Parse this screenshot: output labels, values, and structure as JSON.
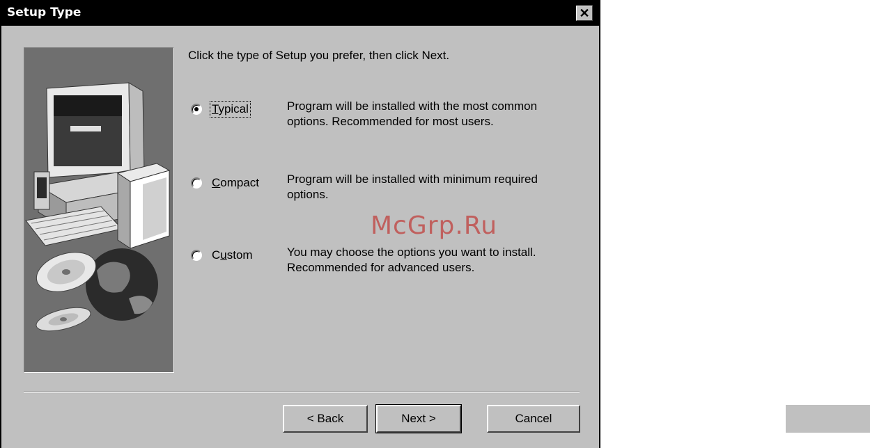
{
  "window": {
    "title": "Setup Type",
    "close_symbol": "✕"
  },
  "instruction": "Click the type of Setup you prefer, then click Next.",
  "options": [
    {
      "label": "Typical",
      "mnemonic": "T",
      "selected": true,
      "description": [
        "Program will be installed with the most common",
        "options.  Recommended for most users."
      ]
    },
    {
      "label": "Compact",
      "mnemonic": "C",
      "selected": false,
      "description": [
        "Program will be installed with minimum required",
        "options."
      ]
    },
    {
      "label": "Custom",
      "mnemonic": "u",
      "selected": false,
      "description": [
        "You may choose the options you want to install.",
        "Recommended for advanced users."
      ]
    }
  ],
  "buttons": {
    "back": "< Back",
    "next": "Next >",
    "cancel": "Cancel"
  },
  "watermark": "McGrp.Ru"
}
